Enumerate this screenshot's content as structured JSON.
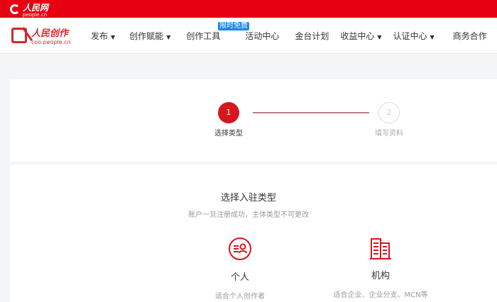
{
  "topbar": {
    "logo_text": "人民网",
    "logo_sub": "people.cn"
  },
  "nav": {
    "brand_title": "人民创作",
    "brand_domain": "coo.people.cn",
    "items": [
      {
        "label": "发布",
        "dropdown": true
      },
      {
        "label": "创作赋能",
        "dropdown": true
      },
      {
        "label": "创作工具",
        "dropdown": false
      },
      {
        "label": "活动中心",
        "dropdown": false
      },
      {
        "label": "金台计划",
        "dropdown": false
      },
      {
        "label": "收益中心",
        "dropdown": true
      },
      {
        "label": "认证中心",
        "dropdown": true
      },
      {
        "label": "商务合作",
        "dropdown": false
      }
    ],
    "badge": "限时免费",
    "arrow": "▼"
  },
  "steps": [
    {
      "num": "1",
      "label": "选择类型",
      "active": true
    },
    {
      "num": "2",
      "label": "填写资料",
      "active": false
    }
  ],
  "main": {
    "title": "选择入驻类型",
    "subtitle": "账户一旦注册成功，主体类型不可更改",
    "options": [
      {
        "title": "个人",
        "desc": "适合个人创作者",
        "icon": "person-card-icon"
      },
      {
        "title": "机构",
        "desc": "适合企业、企业分支、MCN等",
        "icon": "building-icon"
      }
    ]
  },
  "colors": {
    "brand_red": "#e60012",
    "step_active": "#d7161c",
    "badge_blue": "#1e88e5"
  }
}
